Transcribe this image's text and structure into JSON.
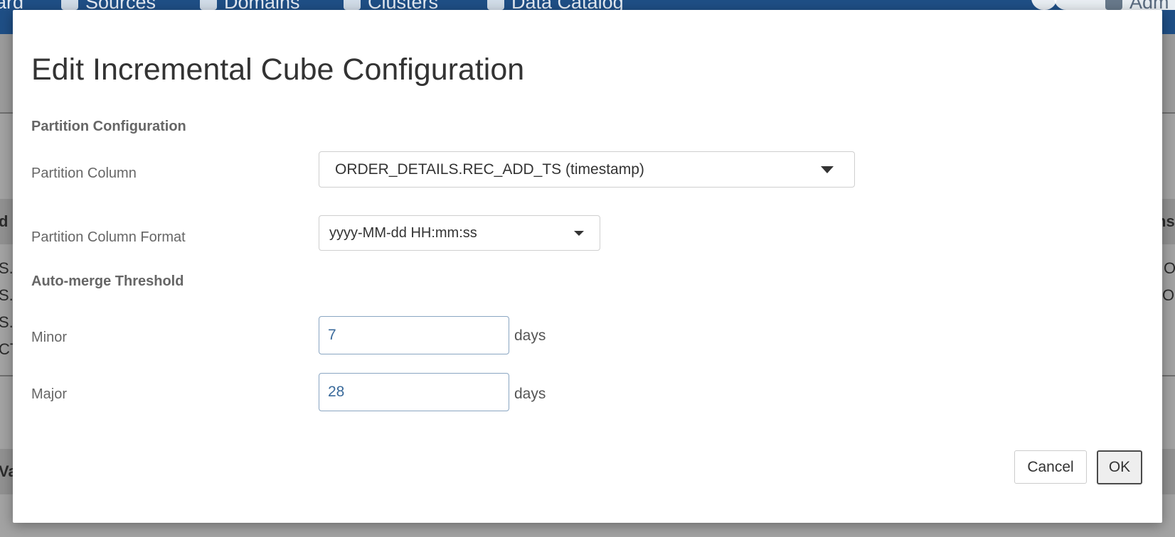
{
  "background": {
    "nav_items": [
      {
        "label": "ard",
        "icon": "dashboard-icon"
      },
      {
        "label": "Sources",
        "icon": "database-icon"
      },
      {
        "label": "Domains",
        "icon": "globe-icon"
      },
      {
        "label": "Clusters",
        "icon": "cluster-icon"
      },
      {
        "label": "Data Catalog",
        "icon": "book-icon"
      },
      {
        "label": "Adm",
        "icon": "wrench-icon"
      }
    ],
    "left_fragments": [
      "d I",
      "S.",
      "S.",
      "S.",
      "CT",
      "Va"
    ],
    "right_fragments": [
      "ns",
      "O",
      "OI"
    ]
  },
  "dialog": {
    "title": "Edit Incremental Cube Configuration",
    "partition_section": "Partition Configuration",
    "partition_column_label": "Partition Column",
    "partition_column_value": "ORDER_DETAILS.REC_ADD_TS (timestamp)",
    "partition_format_label": "Partition Column Format",
    "partition_format_value": "yyyy-MM-dd HH:mm:ss",
    "automerge_section": "Auto-merge Threshold",
    "minor_label": "Minor",
    "minor_value": "7",
    "minor_unit": "days",
    "major_label": "Major",
    "major_value": "28",
    "major_unit": "days",
    "cancel_label": "Cancel",
    "ok_label": "OK"
  },
  "colors": {
    "navbar": "#1f4f86",
    "overlay_page": "#a3a3a3",
    "input_text": "#3a6a9b"
  }
}
